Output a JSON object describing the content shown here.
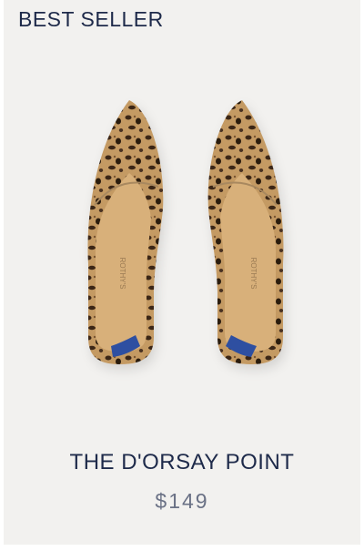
{
  "product": {
    "badge": "BEST SELLER",
    "name": "THE D'ORSAY POINT",
    "price": "$149",
    "brand_mark": "ROTHY'S",
    "colors": {
      "background": "#f2f1ef",
      "title_text": "#1e2a4a",
      "price_text": "#6a7185",
      "leopard_base": "#c49a63",
      "insole": "#d8b07a",
      "heel_tab": "#2d4fa1"
    }
  }
}
